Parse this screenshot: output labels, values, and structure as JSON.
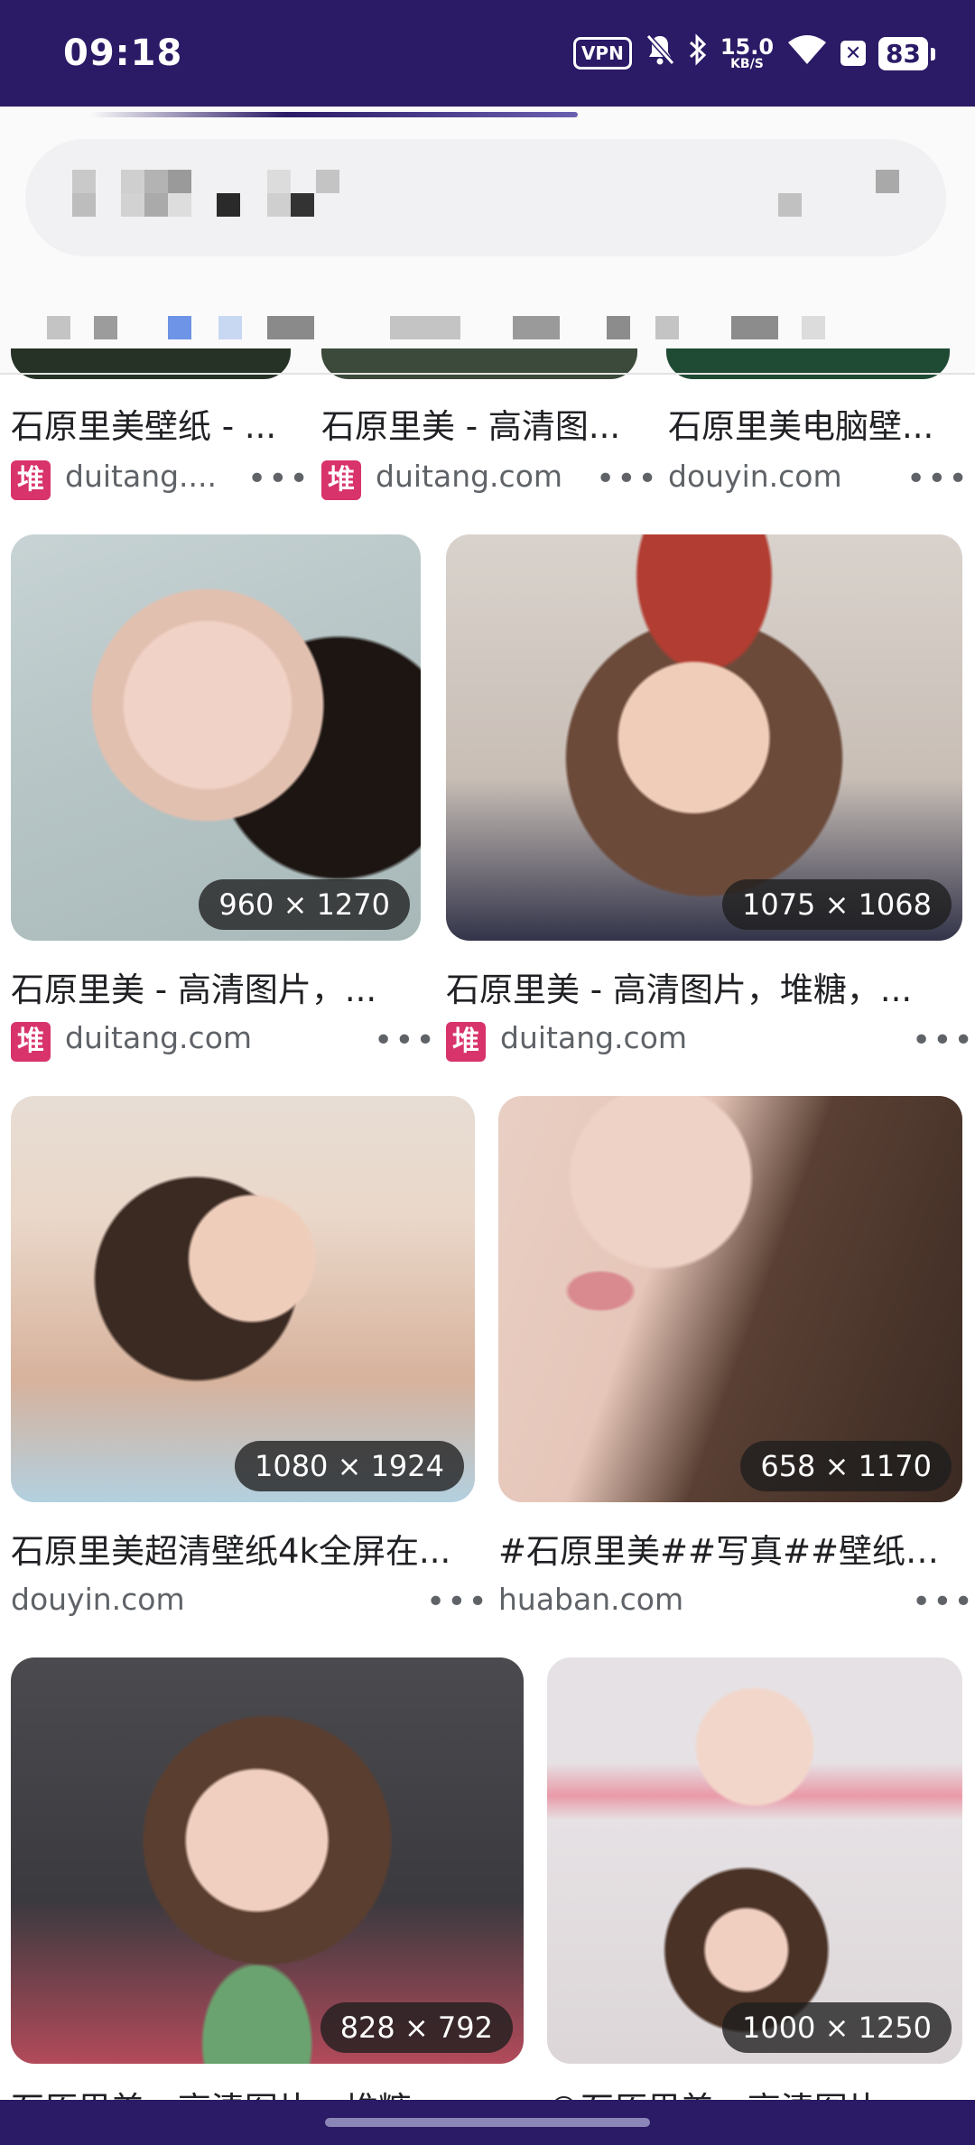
{
  "status_bar": {
    "time": "09:18",
    "vpn": "VPN",
    "net_speed_value": "15.0",
    "net_speed_unit": "KB/S",
    "battery": "83",
    "icons": [
      "vpn-icon",
      "bell-off-icon",
      "bluetooth-icon",
      "wifi-icon",
      "close-box-icon",
      "battery-icon"
    ]
  },
  "colors": {
    "status_bar": "#2b1a66",
    "badge_bg": "#1e1e1e",
    "favicon_duitang": "#d8336a",
    "active_tab": "#4d7fe0"
  },
  "results_row0": [
    {
      "title": "石原里美壁纸 - ...",
      "source": "duitang....",
      "favicon": "堆"
    },
    {
      "title": "石原里美 - 高清图...",
      "source": "duitang.com",
      "favicon": "堆"
    },
    {
      "title": "石原里美电脑壁...",
      "source": "douyin.com"
    }
  ],
  "results": [
    {
      "title": "石原里美 - 高清图片，...",
      "source": "duitang.com",
      "favicon": "堆",
      "dims": "960 × 1270"
    },
    {
      "title": "石原里美 - 高清图片，堆糖，...",
      "source": "duitang.com",
      "favicon": "堆",
      "dims": "1075 × 1068"
    },
    {
      "title": "石原里美超清壁纸4k全屏在...",
      "source": "douyin.com",
      "dims": "1080 × 1924"
    },
    {
      "title": "#石原里美##写真##壁纸#...",
      "source": "huaban.com",
      "dims": "658 × 1170"
    },
    {
      "title": "石原里美 - 高清图片，堆糖...",
      "dims": "828 × 792"
    },
    {
      "title": "©石原里美 - 高清图片...",
      "dims": "1000 × 1250"
    }
  ],
  "more_label": "•••"
}
